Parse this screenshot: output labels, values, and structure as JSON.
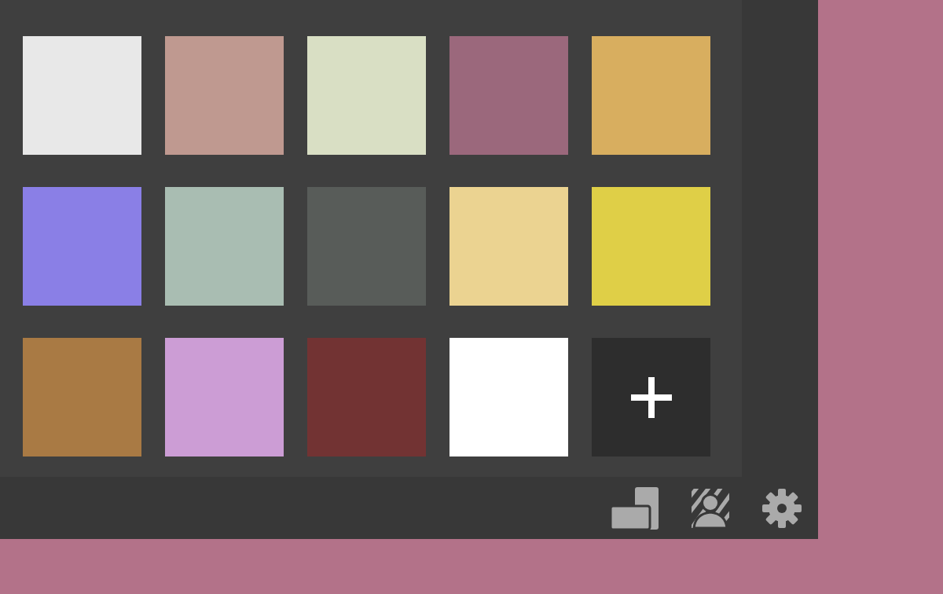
{
  "swatches": [
    {
      "kind": "color",
      "color": "#e8e8e8"
    },
    {
      "kind": "color",
      "color": "#bf9990"
    },
    {
      "kind": "color",
      "color": "#d9dfc4"
    },
    {
      "kind": "color",
      "color": "#9b687c"
    },
    {
      "kind": "color",
      "color": "#d8ae5f"
    },
    {
      "kind": "color",
      "color": "#8a7fe6"
    },
    {
      "kind": "color",
      "color": "#a9bdb2"
    },
    {
      "kind": "color",
      "color": "#585c59"
    },
    {
      "kind": "color",
      "color": "#ebd391"
    },
    {
      "kind": "color",
      "color": "#dfcf47"
    },
    {
      "kind": "color",
      "color": "#a97a44"
    },
    {
      "kind": "color",
      "color": "#cc9dd5"
    },
    {
      "kind": "color",
      "color": "#723333"
    },
    {
      "kind": "color",
      "color": "#ffffff"
    },
    {
      "kind": "add"
    }
  ]
}
